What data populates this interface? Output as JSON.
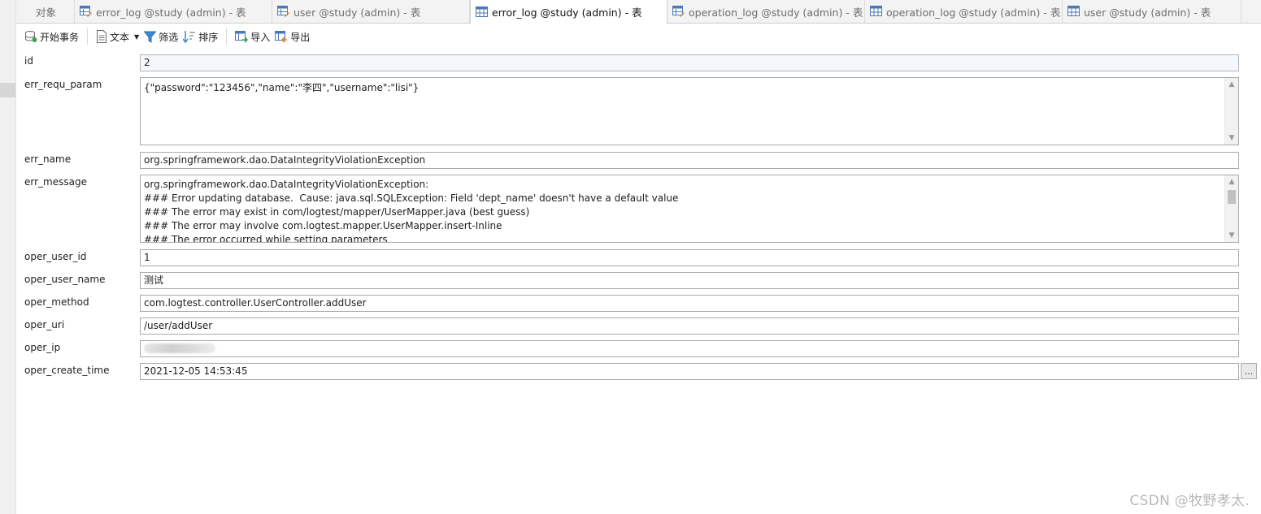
{
  "tabs": [
    {
      "label": "对象",
      "icon": "objects-icon",
      "active": false
    },
    {
      "label": "error_log @study (admin) - 表",
      "icon": "table-design-icon",
      "active": false
    },
    {
      "label": "user @study (admin) - 表",
      "icon": "table-design-icon",
      "active": false
    },
    {
      "label": "error_log @study (admin) - 表",
      "icon": "table-grid-icon",
      "active": true
    },
    {
      "label": "operation_log @study (admin) - 表",
      "icon": "table-design-icon",
      "active": false
    },
    {
      "label": "operation_log @study (admin) - 表",
      "icon": "table-grid-icon",
      "active": false
    },
    {
      "label": "user @study (admin) - 表",
      "icon": "table-grid-icon",
      "active": false
    }
  ],
  "toolbar": {
    "begin_transaction": "开始事务",
    "text": "文本",
    "filter": "筛选",
    "sort": "排序",
    "import": "导入",
    "export": "导出"
  },
  "fields": {
    "id": {
      "label": "id",
      "value": "2"
    },
    "err_requ_param": {
      "label": "err_requ_param",
      "value": "{\"password\":\"123456\",\"name\":\"李四\",\"username\":\"lisi\"}"
    },
    "err_name": {
      "label": "err_name",
      "value": "org.springframework.dao.DataIntegrityViolationException"
    },
    "err_message": {
      "label": "err_message",
      "lines": [
        "org.springframework.dao.DataIntegrityViolationException:",
        "### Error updating database.  Cause: java.sql.SQLException: Field 'dept_name' doesn't have a default value",
        "### The error may exist in com/logtest/mapper/UserMapper.java (best guess)",
        "### The error may involve com.logtest.mapper.UserMapper.insert-Inline",
        "### The error occurred while setting parameters"
      ]
    },
    "oper_user_id": {
      "label": "oper_user_id",
      "value": "1"
    },
    "oper_user_name": {
      "label": "oper_user_name",
      "value": "测试"
    },
    "oper_method": {
      "label": "oper_method",
      "value": "com.logtest.controller.UserController.addUser"
    },
    "oper_uri": {
      "label": "oper_uri",
      "value": "/user/addUser"
    },
    "oper_ip": {
      "label": "oper_ip",
      "value": ""
    },
    "oper_create_time": {
      "label": "oper_create_time",
      "value": "2021-12-05 14:53:45"
    }
  },
  "ellipsis_button": "...",
  "watermark": "CSDN @牧野孝太.",
  "colors": {
    "field_border": "#a9a9a9",
    "active_tab": "#ffffff",
    "tab_bar": "#f3f3f3",
    "toolbar_icon": "#3a7bd5"
  }
}
